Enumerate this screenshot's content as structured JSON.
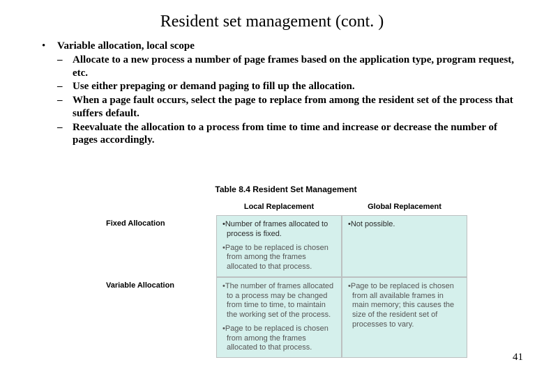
{
  "title": "Resident set management (cont. )",
  "bullet": {
    "heading": "Variable allocation, local scope",
    "items": [
      "Allocate to a new process a number of page frames based on the application type, program request, etc.",
      "Use either prepaging or demand paging to fill up the allocation.",
      "When a page fault occurs, select the page to replace from among the resident set of the process that suffers default.",
      "Reevaluate the allocation to a process from time to time and increase or decrease the number of pages accordingly."
    ]
  },
  "figure": {
    "caption": "Table 8.4  Resident Set Management",
    "col_headers": [
      "",
      "Local Replacement",
      "Global Replacement"
    ],
    "rows": [
      {
        "label": "Fixed Allocation",
        "local": [
          "•Number of frames allocated to process is fixed.",
          "•Page to be replaced is chosen from among the frames allocated to that process."
        ],
        "global": [
          "•Not possible."
        ]
      },
      {
        "label": "Variable Allocation",
        "local": [
          "•The number of frames allocated to a process may be changed from time to time, to maintain the working set of the process.",
          "•Page to be replaced is chosen from among the frames allocated to that process."
        ],
        "global": [
          "•Page to be replaced is chosen from all available frames in main memory; this causes the size of the resident set of processes to vary."
        ]
      }
    ]
  },
  "page_number": "41"
}
